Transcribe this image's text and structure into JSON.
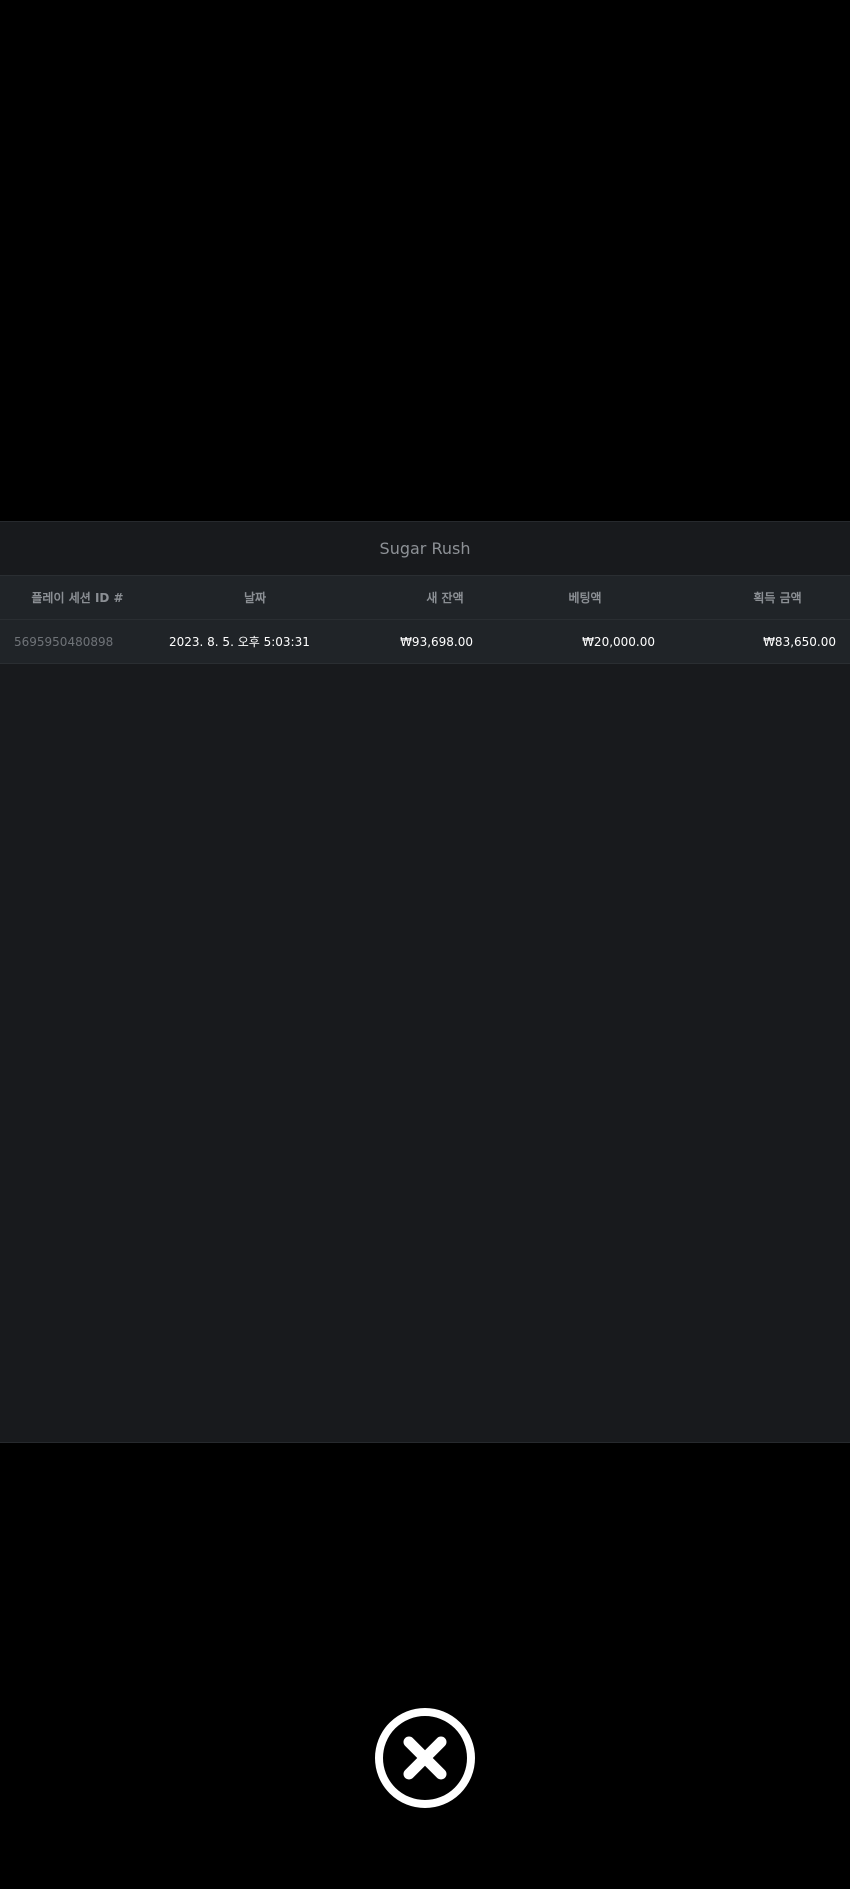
{
  "panel": {
    "title": "Sugar Rush"
  },
  "table": {
    "columns": [
      "플레이 세션 ID #",
      "날짜",
      "새 잔액",
      "베팅액",
      "획득 금액"
    ],
    "rows": [
      {
        "session_id": "5695950480898",
        "date": "2023. 8. 5. 오후 5:03:31",
        "new_balance": "₩93,698.00",
        "bet": "₩20,000.00",
        "win": "₩83,650.00"
      }
    ]
  },
  "close_button": {
    "icon": "close-circle-icon"
  }
}
